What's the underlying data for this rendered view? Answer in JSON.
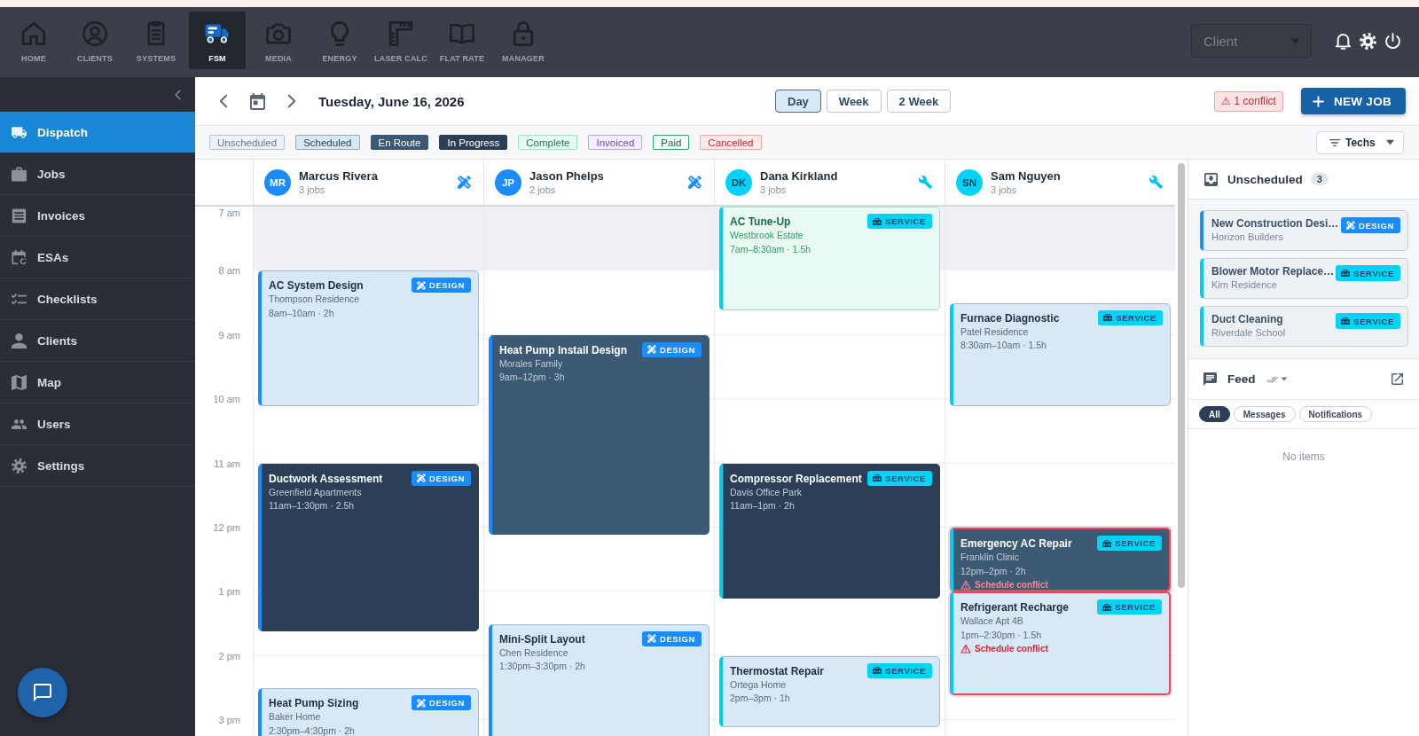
{
  "top_nav": {
    "items": [
      {
        "label": "HOME",
        "selected": false
      },
      {
        "label": "CLIENTS",
        "selected": false
      },
      {
        "label": "SYSTEMS",
        "selected": false
      },
      {
        "label": "FSM",
        "selected": true
      },
      {
        "label": "MEDIA",
        "selected": false
      },
      {
        "label": "ENERGY",
        "selected": false
      },
      {
        "label": "LASER CALC",
        "selected": false
      },
      {
        "label": "FLAT RATE",
        "selected": false
      },
      {
        "label": "MANAGER",
        "selected": false
      }
    ],
    "client_select": {
      "placeholder": "Client"
    }
  },
  "sidebar": {
    "items": [
      {
        "label": "Dispatch",
        "selected": true
      },
      {
        "label": "Jobs",
        "selected": false
      },
      {
        "label": "Invoices",
        "selected": false
      },
      {
        "label": "ESAs",
        "selected": false
      },
      {
        "label": "Checklists",
        "selected": false
      },
      {
        "label": "Clients",
        "selected": false
      },
      {
        "label": "Map",
        "selected": false
      },
      {
        "label": "Users",
        "selected": false
      },
      {
        "label": "Settings",
        "selected": false
      }
    ]
  },
  "toolbar": {
    "date": "Tuesday, June 16, 2026",
    "views": [
      {
        "label": "Day",
        "selected": true
      },
      {
        "label": "Week",
        "selected": false
      },
      {
        "label": "2 Week",
        "selected": false
      }
    ],
    "conflict_badge": "⚠ 1 conflict",
    "new_job_button": "NEW JOB"
  },
  "status_legend": [
    {
      "label": "Unscheduled",
      "kind": "unscheduled"
    },
    {
      "label": "Scheduled",
      "kind": "scheduled"
    },
    {
      "label": "En Route",
      "kind": "en_route"
    },
    {
      "label": "In Progress",
      "kind": "in_progress"
    },
    {
      "label": "Complete",
      "kind": "complete"
    },
    {
      "label": "Invoiced",
      "kind": "invoiced"
    },
    {
      "label": "Paid",
      "kind": "paid"
    },
    {
      "label": "Cancelled",
      "kind": "cancelled"
    }
  ],
  "techs_filter": {
    "label": "Techs"
  },
  "schedule": {
    "hours": [
      "7 am",
      "8 am",
      "9 am",
      "10 am",
      "11 am",
      "12 pm",
      "1 pm",
      "2 pm",
      "3 pm"
    ],
    "techs": [
      {
        "initials": "MR",
        "name": "Marcus Rivera",
        "jobs": "3 jobs",
        "kind": "design",
        "events": [
          {
            "title": "AC System Design",
            "client": "Thompson Residence",
            "time": "8am–10am · 2h",
            "kind": "scheduled",
            "badge": "DESIGN",
            "conflict": false
          },
          {
            "title": "Ductwork Assessment",
            "client": "Greenfield Apartments",
            "time": "11am–1:30pm · 2.5h",
            "kind": "in_progress",
            "badge": "DESIGN",
            "conflict": false
          },
          {
            "title": "Heat Pump Sizing",
            "client": "Baker Home",
            "time": "2:30pm–4:30pm · 2h",
            "kind": "scheduled",
            "badge": "DESIGN",
            "conflict": false
          }
        ]
      },
      {
        "initials": "JP",
        "name": "Jason Phelps",
        "jobs": "2 jobs",
        "kind": "design",
        "events": [
          {
            "title": "Heat Pump Install Design",
            "client": "Morales Family",
            "time": "9am–12pm · 3h",
            "kind": "en_route",
            "badge": "DESIGN",
            "conflict": false
          },
          {
            "title": "Mini-Split Layout",
            "client": "Chen Residence",
            "time": "1:30pm–3:30pm · 2h",
            "kind": "scheduled",
            "badge": "DESIGN",
            "conflict": false
          }
        ]
      },
      {
        "initials": "DK",
        "name": "Dana Kirkland",
        "jobs": "3 jobs",
        "kind": "service",
        "events": [
          {
            "title": "AC Tune-Up",
            "client": "Westbrook Estate",
            "time": "7am–8:30am · 1.5h",
            "kind": "complete",
            "badge": "SERVICE",
            "conflict": false
          },
          {
            "title": "Compressor Replacement",
            "client": "Davis Office Park",
            "time": "11am–1pm · 2h",
            "kind": "in_progress",
            "badge": "SERVICE",
            "conflict": false
          },
          {
            "title": "Thermostat Repair",
            "client": "Ortega Home",
            "time": "2pm–3pm · 1h",
            "kind": "scheduled",
            "badge": "SERVICE",
            "conflict": false
          }
        ]
      },
      {
        "initials": "SN",
        "name": "Sam Nguyen",
        "jobs": "3 jobs",
        "kind": "service",
        "events": [
          {
            "title": "Furnace Diagnostic",
            "client": "Patel Residence",
            "time": "8:30am–10am · 1.5h",
            "kind": "scheduled",
            "badge": "SERVICE",
            "conflict": false
          },
          {
            "title": "Emergency AC Repair",
            "client": "Franklin Clinic",
            "time": "12pm–2pm · 2h",
            "kind": "en_route",
            "badge": "SERVICE",
            "conflict": true,
            "warning": "Schedule conflict"
          },
          {
            "title": "Refrigerant Recharge",
            "client": "Wallace Apt 4B",
            "time": "1pm–2:30pm · 1.5h",
            "kind": "scheduled",
            "badge": "SERVICE",
            "conflict": true,
            "warning": "Schedule conflict"
          }
        ]
      }
    ]
  },
  "unscheduled": {
    "title": "Unscheduled",
    "count": "3",
    "jobs": [
      {
        "title": "New Construction Desi…",
        "client": "Horizon Builders",
        "kind": "design",
        "badge": "DESIGN"
      },
      {
        "title": "Blower Motor Replace…",
        "client": "Kim Residence",
        "kind": "service",
        "badge": "SERVICE"
      },
      {
        "title": "Duct Cleaning",
        "client": "Riverdale School",
        "kind": "service",
        "badge": "SERVICE"
      }
    ]
  },
  "feed": {
    "title": "Feed",
    "filters": [
      {
        "label": "All",
        "selected": true
      },
      {
        "label": "Messages",
        "selected": false
      },
      {
        "label": "Notifications",
        "selected": false
      }
    ],
    "empty_text": "No items"
  }
}
